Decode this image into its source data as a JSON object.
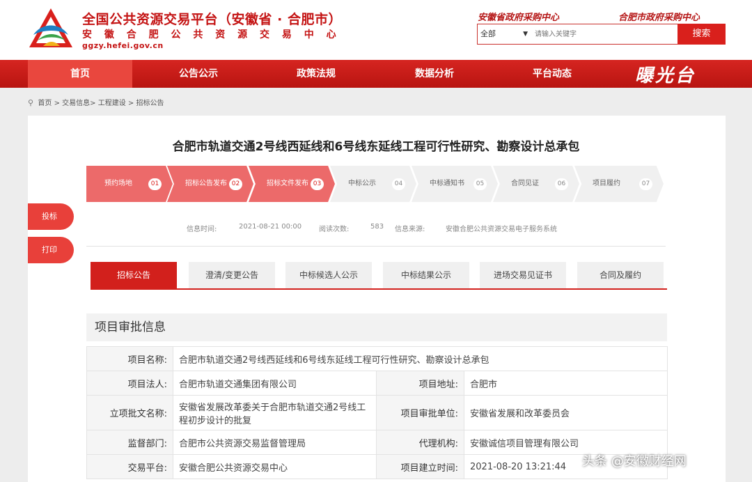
{
  "header": {
    "title": "全国公共资源交易平台（安徽省 · 合肥市）",
    "subtitle": "安 徽 合 肥 公 共 资 源 交 易 中 心",
    "url": "ggzy.hefei.gov.cn",
    "link_province": "安徽省政府采购中心",
    "link_city": "合肥市政府采购中心"
  },
  "search": {
    "select_value": "全部",
    "placeholder": "请输入关键字",
    "button": "搜索"
  },
  "nav": {
    "items": [
      {
        "label": "首页"
      },
      {
        "label": "公告公示"
      },
      {
        "label": "政策法规"
      },
      {
        "label": "数据分析"
      },
      {
        "label": "平台动态"
      }
    ],
    "special": "曝光台"
  },
  "breadcrumb": {
    "home": "首页",
    "level1": "交易信息",
    "level2": "工程建设",
    "level3": "招标公告"
  },
  "project": {
    "title": "合肥市轨道交通2号线西延线和6号线东延线工程可行性研究、勘察设计总承包"
  },
  "steps": [
    {
      "label": "预约场地",
      "num": "01",
      "done": true
    },
    {
      "label": "招标公告发布",
      "num": "02",
      "done": true
    },
    {
      "label": "招标文件发布",
      "num": "03",
      "done": true
    },
    {
      "label": "中标公示",
      "num": "04",
      "done": false
    },
    {
      "label": "中标通知书",
      "num": "05",
      "done": false
    },
    {
      "label": "合同见证",
      "num": "06",
      "done": false
    },
    {
      "label": "项目履约",
      "num": "07",
      "done": false
    }
  ],
  "side": {
    "submit": "投标",
    "print": "打印"
  },
  "meta": {
    "time_label": "信息时间:",
    "time_value": "2021-08-21 00:00",
    "views_label": "阅读次数:",
    "views_value": "583",
    "source_label": "信息来源:",
    "source_value": "安徽合肥公共资源交易电子服务系统"
  },
  "tabs": [
    {
      "label": "招标公告"
    },
    {
      "label": "澄清/变更公告"
    },
    {
      "label": "中标候选人公示"
    },
    {
      "label": "中标结果公示"
    },
    {
      "label": "进场交易见证书"
    },
    {
      "label": "合同及履约"
    }
  ],
  "section_title": "项目审批信息",
  "table": {
    "name_label": "项目名称:",
    "name_value": "合肥市轨道交通2号线西延线和6号线东延线工程可行性研究、勘察设计总承包",
    "legal_label": "项目法人:",
    "legal_value": "合肥市轨道交通集团有限公司",
    "address_label": "项目地址:",
    "address_value": "合肥市",
    "approval_doc_label": "立项批文名称:",
    "approval_doc_value": "安徽省发展改革委关于合肥市轨道交通2号线工程初步设计的批复",
    "approval_unit_label": "项目审批单位:",
    "approval_unit_value": "安徽省发展和改革委员会",
    "supervisor_label": "监督部门:",
    "supervisor_value": "合肥市公共资源交易监督管理局",
    "agent_label": "代理机构:",
    "agent_value": "安徽诚信项目管理有限公司",
    "platform_label": "交易平台:",
    "platform_value": "安徽合肥公共资源交易中心",
    "created_label": "项目建立时间:",
    "created_value": "2021-08-20 13:21:44"
  },
  "watermark": "头条 @安徽财经网",
  "colors": {
    "brand_red": "#d2201c",
    "step_done": "#ec6a6a"
  }
}
